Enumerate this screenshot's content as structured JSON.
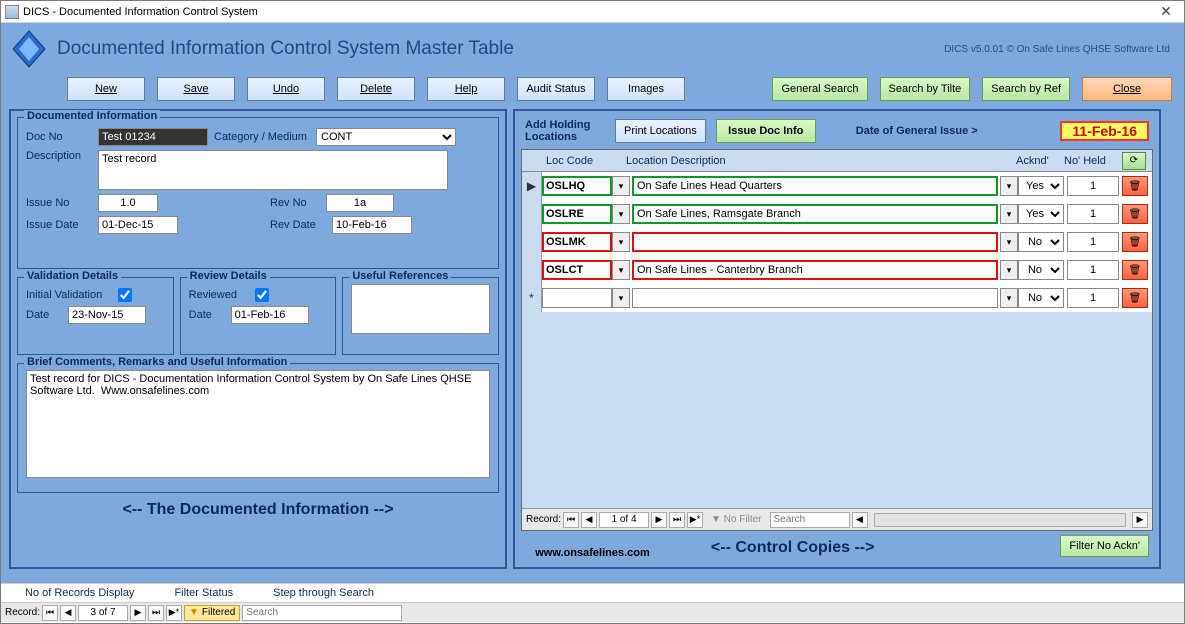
{
  "window_title": "DICS - Documented Information Control System",
  "header_title": "Documented Information Control System Master Table",
  "version_text": "DICS v5.0.01 © On Safe Lines QHSE Software Ltd",
  "toolbar": {
    "new": "New",
    "save": "Save",
    "undo": "Undo",
    "delete": "Delete",
    "help": "Help",
    "audit": "Audit Status",
    "images": "Images",
    "gsearch": "General Search",
    "stitle": "Search by Tilte",
    "sref": "Search by Ref",
    "close": "Close"
  },
  "doc_info": {
    "title": "Documented Information",
    "docno_lbl": "Doc No",
    "docno": "Test 01234",
    "cat_lbl": "Category / Medium",
    "cat": "CONT",
    "desc_lbl": "Description",
    "desc": "Test record",
    "issue_lbl": "Issue No",
    "issue": "1.0",
    "revno_lbl": "Rev No",
    "revno": "1a",
    "idate_lbl": "Issue Date",
    "idate": "01-Dec-15",
    "rdate_lbl": "Rev Date",
    "rdate": "10-Feb-16"
  },
  "validation": {
    "title": "Validation Details",
    "init_lbl": "Initial Validation",
    "date_lbl": "Date",
    "date": "23-Nov-15"
  },
  "review": {
    "title": "Review Details",
    "rev_lbl": "Reviewed",
    "date_lbl": "Date",
    "date": "01-Feb-16"
  },
  "useful": {
    "title": "Useful References"
  },
  "comments": {
    "title": "Brief Comments, Remarks and Useful Information",
    "text": "Test record for DICS - Documentation Information Control System by On Safe Lines QHSE Software Ltd.  Www.onsafelines.com"
  },
  "left_footer": "<--  The Documented Information  -->",
  "holding": {
    "title": "Add Holding Locations",
    "print": "Print Locations",
    "issue": "Issue Doc Info",
    "gi_lbl": "Date of General Issue   >",
    "gi_date": "11-Feb-16",
    "head_code": "Loc Code",
    "head_desc": "Location Description",
    "head_ack": "Acknd'",
    "head_no": "No' Held",
    "rows": [
      {
        "code": "OSLHQ",
        "desc": "On Safe Lines Head Quarters",
        "ack": "Yes",
        "no": "1",
        "color": "green"
      },
      {
        "code": "OSLRE",
        "desc": "On Safe Lines, Ramsgate Branch",
        "ack": "Yes",
        "no": "1",
        "color": "green"
      },
      {
        "code": "OSLMK",
        "desc": "",
        "ack": "No",
        "no": "1",
        "color": "red"
      },
      {
        "code": "OSLCT",
        "desc": "On Safe Lines - Canterbry Branch",
        "ack": "No",
        "no": "1",
        "color": "red"
      }
    ],
    "new_ack": "No",
    "new_no": "1"
  },
  "grid_nav": {
    "label": "Record:",
    "pos": "1 of 4",
    "nofilter": "No Filter",
    "search": "Search"
  },
  "right_footer": "<--  Control Copies  -->",
  "filter_no_ackn": "Filter No Ackn'",
  "website": "www.onsafelines.com",
  "status": {
    "recs": "No of Records Display",
    "fstat": "Filter Status",
    "step": "Step through Search",
    "nav_label": "Record:",
    "nav_pos": "3 of 7",
    "filtered": "Filtered",
    "search": "Search"
  }
}
